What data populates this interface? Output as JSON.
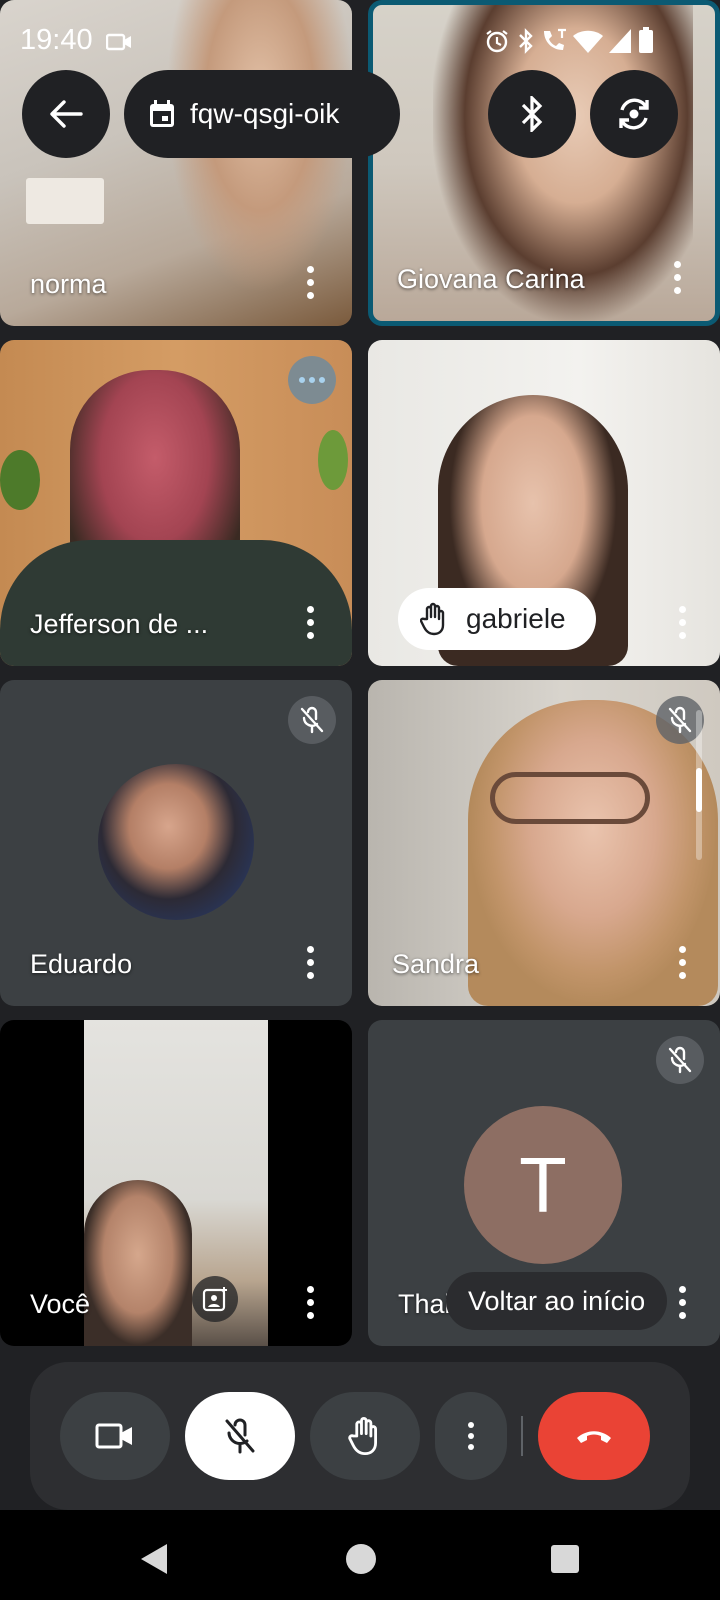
{
  "status_bar": {
    "time": "19:40"
  },
  "meeting": {
    "code": "fqw-qsgi-oik"
  },
  "tiles": [
    {
      "name": "norma"
    },
    {
      "name": "Giovana Carina"
    },
    {
      "name": "Jefferson de ..."
    },
    {
      "name": "gabriele"
    },
    {
      "name": "Eduardo"
    },
    {
      "name": "Sandra"
    },
    {
      "name": "Você"
    },
    {
      "name": "Thais",
      "avatar_letter": "T"
    }
  ],
  "tooltip": {
    "text": "Voltar ao início"
  },
  "colors": {
    "background": "#202124",
    "tile_dark": "#3c4043",
    "end_call": "#ea4335",
    "active_speaker_border": "#0b5a73",
    "avatar_t": "#8d6e63"
  },
  "icons": [
    "back-arrow-icon",
    "calendar-icon",
    "bluetooth-icon",
    "switch-camera-icon",
    "camera-icon",
    "mic-off-icon",
    "raise-hand-icon",
    "more-vert-icon",
    "end-call-icon",
    "nav-back-icon",
    "nav-home-icon",
    "nav-recents-icon"
  ]
}
